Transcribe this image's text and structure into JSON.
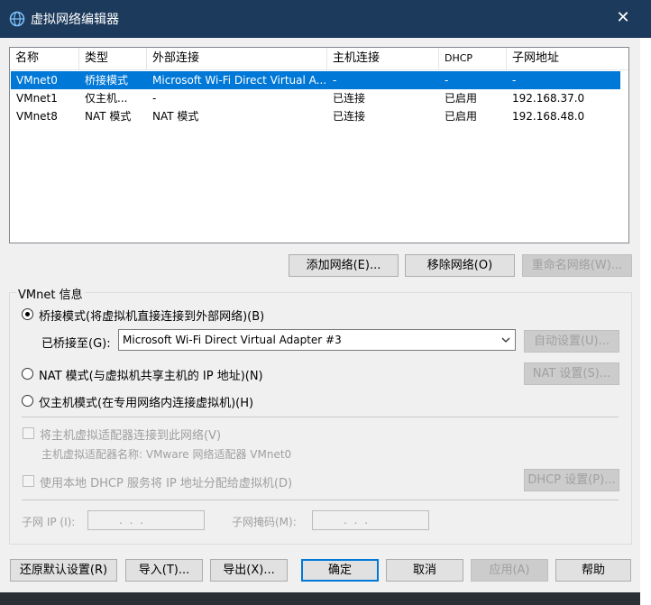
{
  "window": {
    "title": "虚拟网络编辑器",
    "close_glyph": "✕",
    "icon": "network-globe-icon"
  },
  "network_table": {
    "columns": [
      "名称",
      "类型",
      "外部连接",
      "主机连接",
      "DHCP",
      "子网地址"
    ],
    "rows": [
      {
        "name": "VMnet0",
        "type": "桥接模式",
        "external": "Microsoft Wi-Fi Direct Virtual A...",
        "host": "-",
        "dhcp": "-",
        "subnet": "-",
        "selected": true
      },
      {
        "name": "VMnet1",
        "type": "仅主机...",
        "external": "-",
        "host": "已连接",
        "dhcp": "已启用",
        "subnet": "192.168.37.0",
        "selected": false
      },
      {
        "name": "VMnet8",
        "type": "NAT 模式",
        "external": "NAT 模式",
        "host": "已连接",
        "dhcp": "已启用",
        "subnet": "192.168.48.0",
        "selected": false
      }
    ]
  },
  "table_buttons": {
    "add": "添加网络(E)...",
    "remove": "移除网络(O)",
    "rename": "重命名网络(W)..."
  },
  "vmnet_info": {
    "title": "VMnet 信息",
    "bridged_label": "桥接模式(将虚拟机直接连接到外部网络)(B)",
    "bridged_to_label": "已桥接至(G):",
    "bridged_to_value": "Microsoft Wi-Fi Direct Virtual Adapter #3",
    "auto_settings": "自动设置(U)...",
    "nat_label": "NAT 模式(与虚拟机共享主机的 IP 地址)(N)",
    "nat_settings": "NAT 设置(S)...",
    "hostonly_label": "仅主机模式(在专用网络内连接虚拟机)(H)",
    "connect_adapter_label": "将主机虚拟适配器连接到此网络(V)",
    "adapter_name_label": "主机虚拟适配器名称: VMware 网络适配器 VMnet0",
    "dhcp_label": "使用本地 DHCP 服务将 IP 地址分配给虚拟机(D)",
    "dhcp_settings": "DHCP 设置(P)...",
    "subnet_ip_label": "子网 IP (I):",
    "subnet_ip_value": ". . .",
    "subnet_mask_label": "子网掩码(M):",
    "subnet_mask_value": ". . .",
    "selected_mode": "bridged"
  },
  "footer_buttons": {
    "restore": "还原默认设置(R)",
    "import": "导入(T)...",
    "export": "导出(X)...",
    "ok": "确定",
    "cancel": "取消",
    "apply": "应用(A)",
    "help": "帮助"
  },
  "colors": {
    "titlebar": "#1c3a5b",
    "selection": "#0078d7",
    "dialog_bg": "#f0f0f0"
  }
}
